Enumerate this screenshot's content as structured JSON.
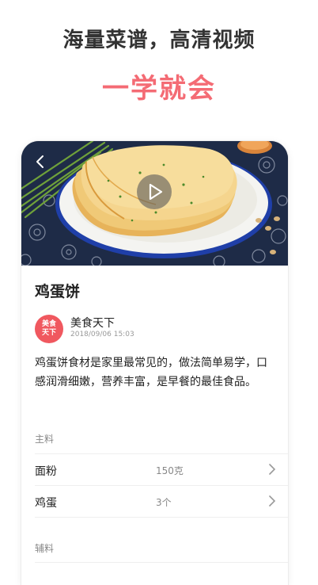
{
  "promo": {
    "headline": "海量菜谱，高清视频",
    "subline": "一学就会"
  },
  "recipe": {
    "title": "鸡蛋饼",
    "author": {
      "avatar_text": "美食天下",
      "name": "美食天下",
      "date": "2018/09/06 15:03"
    },
    "description": "鸡蛋饼食材是家里最常见的，做法简单易学，口感润滑细嫩，营养丰富，是早餐的最佳食品。",
    "main_section_label": "主料",
    "main_ingredients": [
      {
        "name": "面粉",
        "amount": "150克"
      },
      {
        "name": "鸡蛋",
        "amount": "3个"
      }
    ],
    "secondary_section_label": "辅料"
  },
  "icons": {
    "back": "chevron-left-icon",
    "play": "play-icon",
    "row_chevron": "chevron-right-icon"
  },
  "colors": {
    "accent": "#f46b74",
    "avatar_bg": "#f0585f"
  }
}
